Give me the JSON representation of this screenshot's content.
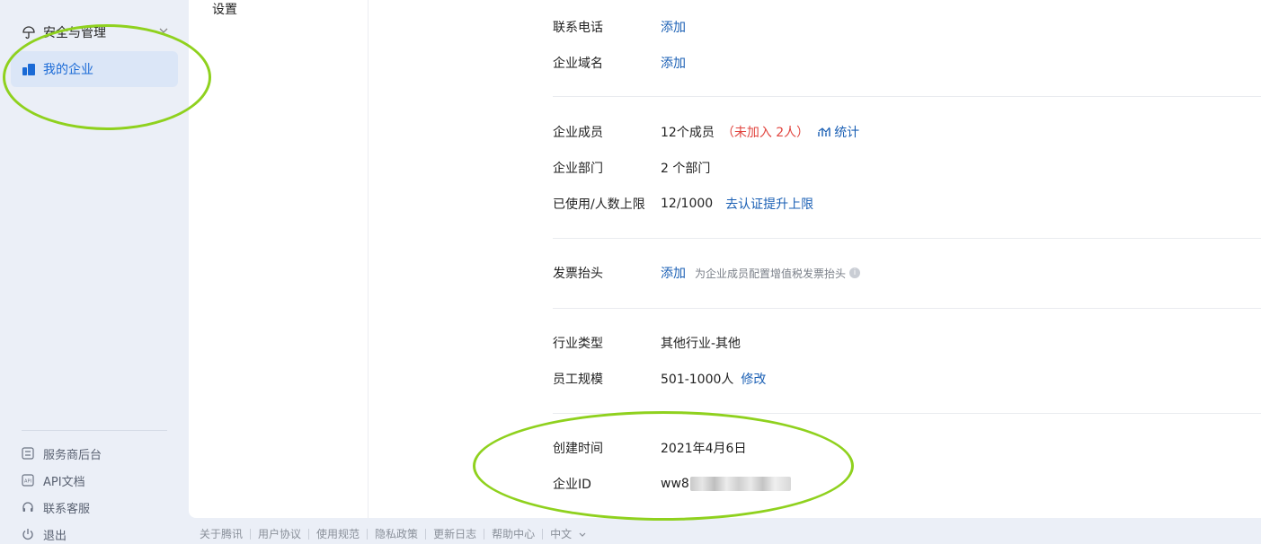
{
  "sidebar": {
    "group_label": "安全与管理",
    "active_item_label": "我的企业",
    "bottom_links": [
      {
        "label": "服务商后台",
        "icon": "grid-icon"
      },
      {
        "label": "API文档",
        "icon": "api-doc-icon"
      },
      {
        "label": "联系客服",
        "icon": "headset-icon"
      },
      {
        "label": "退出",
        "icon": "power-icon"
      }
    ]
  },
  "subnav": {
    "item_label": "设置"
  },
  "info": {
    "phone": {
      "key": "联系电话",
      "action": "添加"
    },
    "domain": {
      "key": "企业域名",
      "action": "添加"
    },
    "members": {
      "key": "企业成员",
      "value": "12个成员",
      "not_joined": "（未加入 2人）",
      "stats_link": "统计"
    },
    "departments": {
      "key": "企业部门",
      "value": "2 个部门"
    },
    "usage": {
      "key": "已使用/人数上限",
      "value": "12/1000",
      "link": "去认证提升上限"
    },
    "invoice": {
      "key": "发票抬头",
      "action": "添加",
      "hint": "为企业成员配置增值税发票抬头",
      "hint_icon": "i"
    },
    "industry": {
      "key": "行业类型",
      "value": "其他行业-其他"
    },
    "scale": {
      "key": "员工规模",
      "value": "501-1000人",
      "link": "修改"
    },
    "created": {
      "key": "创建时间",
      "value": "2021年4月6日"
    },
    "corp_id": {
      "key": "企业ID",
      "value_visible": "ww8"
    }
  },
  "footer": [
    "关于腾讯",
    "用户协议",
    "使用规范",
    "隐私政策",
    "更新日志",
    "帮助中心",
    "中文"
  ],
  "colors": {
    "accent": "#1a5fb4",
    "warn": "#e1453f",
    "annotation": "#8fd11e"
  }
}
